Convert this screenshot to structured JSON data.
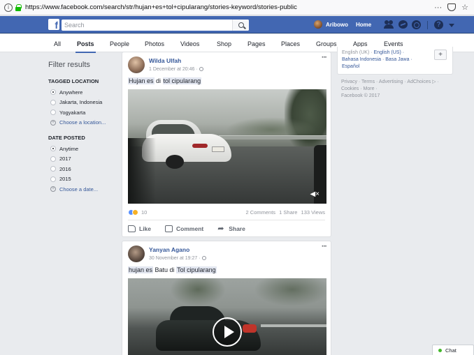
{
  "browser": {
    "url": "https://www.facebook.com/search/str/hujan+es+tol+cipularang/stories-keyword/stories-public",
    "info_glyph": "i",
    "menu_glyph": "···",
    "star_glyph": "☆"
  },
  "header": {
    "logo": "f",
    "search_placeholder": "Search",
    "user_name": "Aribowo",
    "home_label": "Home",
    "help_glyph": "?"
  },
  "tabs": [
    {
      "label": "All",
      "active": false
    },
    {
      "label": "Posts",
      "active": true
    },
    {
      "label": "People",
      "active": false
    },
    {
      "label": "Photos",
      "active": false
    },
    {
      "label": "Videos",
      "active": false
    },
    {
      "label": "Shop",
      "active": false
    },
    {
      "label": "Pages",
      "active": false
    },
    {
      "label": "Places",
      "active": false
    },
    {
      "label": "Groups",
      "active": false
    },
    {
      "label": "Apps",
      "active": false
    },
    {
      "label": "Events",
      "active": false
    }
  ],
  "filters": {
    "title": "Filter results",
    "location": {
      "heading": "TAGGED LOCATION",
      "options": [
        "Anywhere",
        "Jakarta, Indonesia",
        "Yogyakarta"
      ],
      "selected": 0,
      "choose_label": "Choose a location..."
    },
    "date": {
      "heading": "DATE POSTED",
      "options": [
        "Anytime",
        "2017",
        "2016",
        "2015"
      ],
      "selected": 0,
      "choose_label": "Choose a date..."
    }
  },
  "posts": [
    {
      "author": "Wilda Ulfah",
      "time": "1 December at 20:46 ·",
      "text_parts": [
        "Hujan es",
        " di ",
        "tol cipularang"
      ],
      "reaction_count": "10",
      "comments": "2 Comments",
      "shares": "1 Share",
      "views": "133 Views",
      "mute_glyph": "◀×"
    },
    {
      "author": "Yanyan Agano",
      "time": "30 November at 19:27 ·",
      "text_parts": [
        "hujan es",
        " Batu di ",
        "Tol cipularang"
      ]
    }
  ],
  "post_actions": {
    "like": "Like",
    "comment": "Comment",
    "share": "Share",
    "more_glyph": "···"
  },
  "right_column": {
    "languages_line1": "English (UK) · ",
    "languages_line1_link": "English (US) ·",
    "languages_line2": "Bahasa Indonesia · Basa Jawa ·",
    "languages_line3": "Español",
    "add_glyph": "+",
    "footer_line1": "Privacy · Terms · Advertising · AdChoices ▷ ·",
    "footer_line2": "Cookies · More ·",
    "footer_line3": "Facebook © 2017"
  },
  "chat": {
    "label": "Chat",
    "online_color": "#42b72a"
  },
  "colors": {
    "brand_blue": "#4267b2",
    "link_blue": "#365899",
    "background": "#e9ebee"
  }
}
